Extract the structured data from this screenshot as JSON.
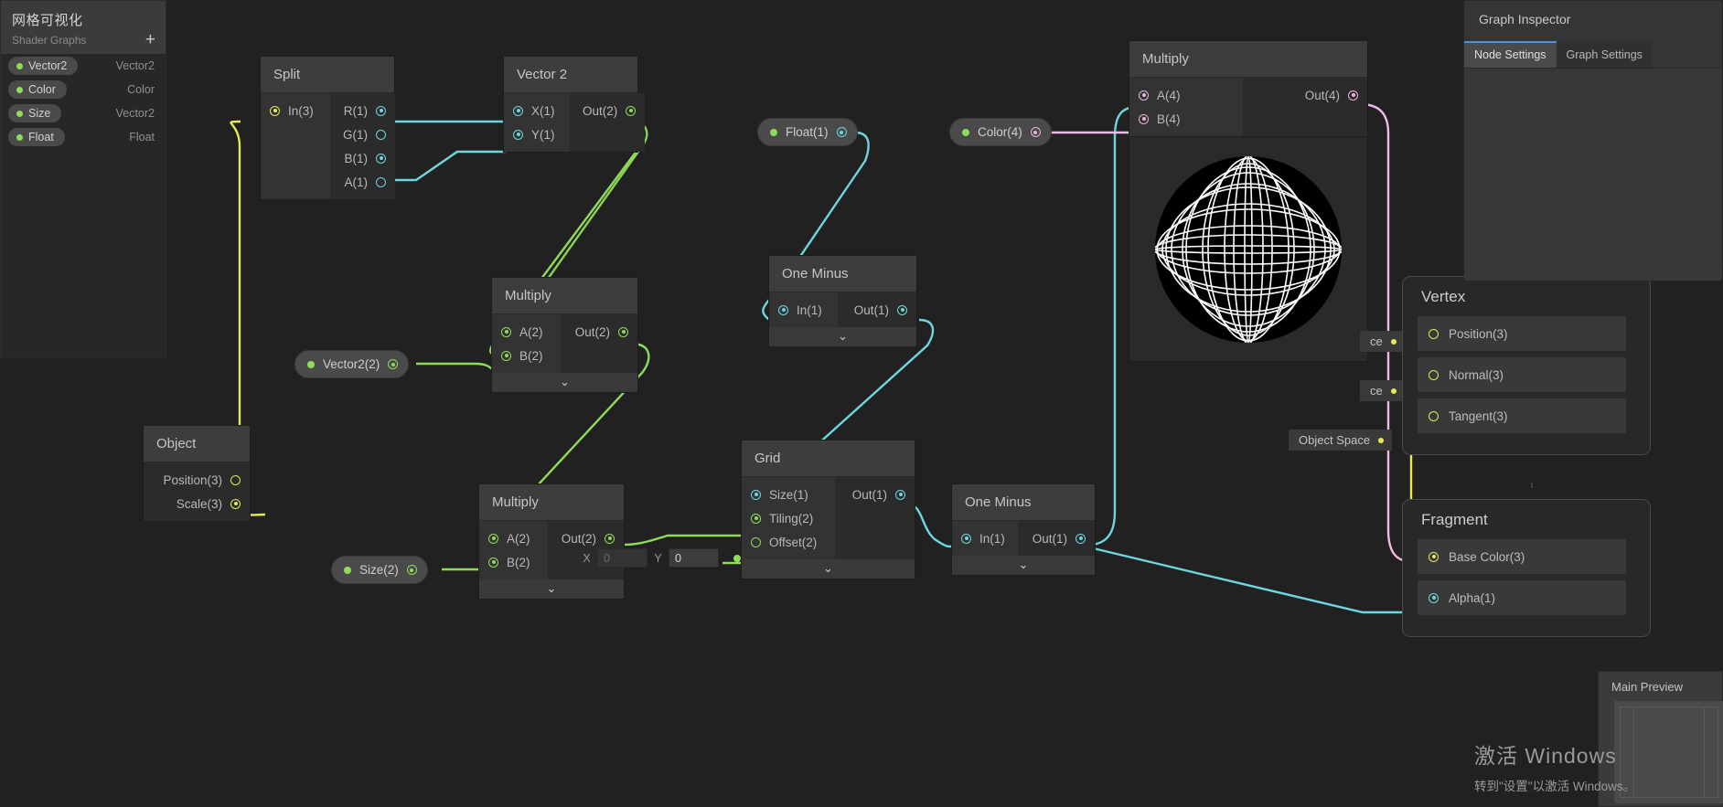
{
  "blackboard": {
    "title": "网格可视化",
    "subtitle": "Shader Graphs",
    "add_label": "+",
    "properties": [
      {
        "name": "Vector2",
        "type": "Vector2"
      },
      {
        "name": "Color",
        "type": "Color"
      },
      {
        "name": "Size",
        "type": "Vector2"
      },
      {
        "name": "Float",
        "type": "Float"
      }
    ]
  },
  "inspector": {
    "title": "Graph Inspector",
    "tabs": [
      {
        "label": "Node Settings",
        "active": true
      },
      {
        "label": "Graph Settings",
        "active": false
      }
    ]
  },
  "main_preview": {
    "title": "Main Preview"
  },
  "watermark": {
    "line1": "激活 Windows",
    "line2": "转到\"设置\"以激活 Windows。"
  },
  "nodes": {
    "split": {
      "title": "Split",
      "inputs": [
        {
          "label": "In(3)",
          "color": "yellow",
          "filled": true
        }
      ],
      "outputs": [
        {
          "label": "R(1)",
          "color": "cyan",
          "filled": true
        },
        {
          "label": "G(1)",
          "color": "cyan",
          "filled": false
        },
        {
          "label": "B(1)",
          "color": "cyan",
          "filled": true
        },
        {
          "label": "A(1)",
          "color": "cyan",
          "filled": false
        }
      ]
    },
    "vector2": {
      "title": "Vector 2",
      "inputs": [
        {
          "label": "X(1)",
          "color": "cyan",
          "filled": true
        },
        {
          "label": "Y(1)",
          "color": "cyan",
          "filled": true
        }
      ],
      "outputs": [
        {
          "label": "Out(2)",
          "color": "green",
          "filled": true
        }
      ]
    },
    "multiply_mid": {
      "title": "Multiply",
      "inputs": [
        {
          "label": "A(2)",
          "color": "green",
          "filled": true
        },
        {
          "label": "B(2)",
          "color": "green",
          "filled": true
        }
      ],
      "outputs": [
        {
          "label": "Out(2)",
          "color": "green",
          "filled": true
        }
      ]
    },
    "multiply_low": {
      "title": "Multiply",
      "inputs": [
        {
          "label": "A(2)",
          "color": "green",
          "filled": true
        },
        {
          "label": "B(2)",
          "color": "green",
          "filled": true
        }
      ],
      "outputs": [
        {
          "label": "Out(2)",
          "color": "green",
          "filled": true
        }
      ],
      "vector_field": {
        "x_label": "X",
        "x_value": "0",
        "y_label": "Y",
        "y_value": "0"
      }
    },
    "one_minus_top": {
      "title": "One Minus",
      "inputs": [
        {
          "label": "In(1)",
          "color": "cyan",
          "filled": true
        }
      ],
      "outputs": [
        {
          "label": "Out(1)",
          "color": "cyan",
          "filled": true
        }
      ]
    },
    "grid": {
      "title": "Grid",
      "inputs": [
        {
          "label": "Size(1)",
          "color": "cyan",
          "filled": true
        },
        {
          "label": "Tiling(2)",
          "color": "green",
          "filled": true
        },
        {
          "label": "Offset(2)",
          "color": "green",
          "filled": false
        }
      ],
      "outputs": [
        {
          "label": "Out(1)",
          "color": "cyan",
          "filled": true
        }
      ]
    },
    "one_minus_low": {
      "title": "One Minus",
      "inputs": [
        {
          "label": "In(1)",
          "color": "cyan",
          "filled": true
        }
      ],
      "outputs": [
        {
          "label": "Out(1)",
          "color": "cyan",
          "filled": true
        }
      ]
    },
    "multiply_top": {
      "title": "Multiply",
      "inputs": [
        {
          "label": "A(4)",
          "color": "pink",
          "filled": true
        },
        {
          "label": "B(4)",
          "color": "pink",
          "filled": true
        }
      ],
      "outputs": [
        {
          "label": "Out(4)",
          "color": "pink",
          "filled": true
        }
      ]
    },
    "object": {
      "title": "Object",
      "outputs": [
        {
          "label": "Position(3)",
          "color": "yellow",
          "filled": false
        },
        {
          "label": "Scale(3)",
          "color": "yellow",
          "filled": true
        }
      ]
    }
  },
  "property_nodes": [
    {
      "id": "vector2_prop",
      "label": "Vector2(2)",
      "color": "green"
    },
    {
      "id": "size_prop",
      "label": "Size(2)",
      "color": "green"
    },
    {
      "id": "float_prop",
      "label": "Float(1)",
      "color": "cyan"
    },
    {
      "id": "color_prop",
      "label": "Color(4)",
      "color": "pink"
    }
  ],
  "master_stack": {
    "vertex": {
      "title": "Vertex",
      "rows": [
        {
          "label": "Position(3)",
          "color": "yellow"
        },
        {
          "label": "Normal(3)",
          "color": "yellow"
        },
        {
          "label": "Tangent(3)",
          "color": "yellow"
        }
      ],
      "space_tags": [
        "ce",
        "ce",
        "Object Space"
      ]
    },
    "fragment": {
      "title": "Fragment",
      "rows": [
        {
          "label": "Base Color(3)",
          "color": "yellow"
        },
        {
          "label": "Alpha(1)",
          "color": "cyan"
        }
      ]
    }
  },
  "colors": {
    "wire_cyan": "#6fd6e0",
    "wire_green": "#8fdc5a",
    "wire_yellow": "#e8e85a",
    "wire_pink": "#efbbe6",
    "node_bg": "#2b2b2b",
    "node_header": "#3d3d3d",
    "canvas_bg": "#212121",
    "accent_blue": "#4f8fd6"
  }
}
